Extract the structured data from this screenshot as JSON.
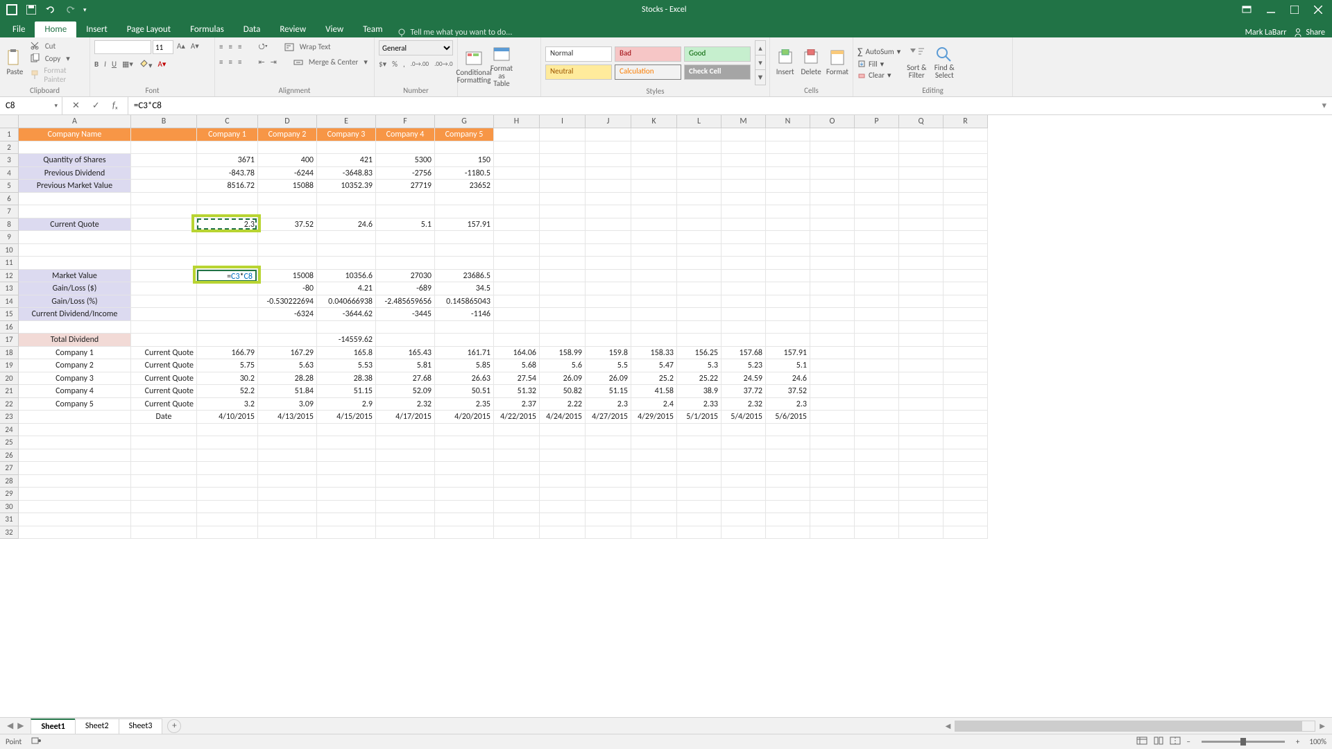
{
  "title": "Stocks - Excel",
  "user": "Mark LaBarr",
  "share": "Share",
  "tabs": [
    "File",
    "Home",
    "Insert",
    "Page Layout",
    "Formulas",
    "Data",
    "Review",
    "View",
    "Team"
  ],
  "activeTab": 1,
  "tellme": "Tell me what you want to do...",
  "ribbon": {
    "clipboard": {
      "label": "Clipboard",
      "paste": "Paste",
      "cut": "Cut",
      "copy": "Copy",
      "fp": "Format Painter"
    },
    "font": {
      "label": "Font",
      "size": "11"
    },
    "alignment": {
      "label": "Alignment",
      "wrap": "Wrap Text",
      "merge": "Merge & Center"
    },
    "number": {
      "label": "Number",
      "fmt": "General"
    },
    "cond": "Conditional Formatting",
    "fmtas": "Format as Table",
    "styles": {
      "label": "Styles",
      "cells": [
        "Normal",
        "Bad",
        "Good",
        "Neutral",
        "Calculation",
        "Check Cell"
      ]
    },
    "cells": {
      "label": "Cells",
      "insert": "Insert",
      "delete": "Delete",
      "format": "Format"
    },
    "editing": {
      "label": "Editing",
      "autosum": "AutoSum",
      "fill": "Fill",
      "clear": "Clear",
      "sort": "Sort & Filter",
      "find": "Find & Select"
    }
  },
  "formulaBar": {
    "name": "C8",
    "formula": "=C3*C8"
  },
  "colWidths": {
    "A": 162,
    "B": 95,
    "C": 88,
    "D": 85,
    "E": 85,
    "F": 85,
    "G": 85,
    "H": 66,
    "I": 66,
    "J": 66,
    "K": 66,
    "L": 64,
    "M": 64,
    "N": 64,
    "O": 64,
    "P": 64,
    "Q": 64,
    "R": 64
  },
  "columns": [
    "A",
    "B",
    "C",
    "D",
    "E",
    "F",
    "G",
    "H",
    "I",
    "J",
    "K",
    "L",
    "M",
    "N",
    "O",
    "P",
    "Q",
    "R"
  ],
  "rowCount": 32,
  "sheet": {
    "tabs": [
      "Sheet1",
      "Sheet2",
      "Sheet3"
    ],
    "active": 0
  },
  "status": "Point",
  "zoom": "100%",
  "editCell": {
    "row": 12,
    "col": "C",
    "parts": [
      "=",
      "C3",
      "*",
      "C8"
    ]
  },
  "selRef": {
    "row": 8,
    "col": "C"
  },
  "chart_data": {
    "type": "table",
    "title": "Stocks",
    "companies": [
      "Company 1",
      "Company 2",
      "Company 3",
      "Company 4",
      "Company 5"
    ],
    "quantity_of_shares": [
      3671,
      400,
      421,
      5300,
      150
    ],
    "previous_dividend": [
      -843.78,
      -6244,
      -3648.83,
      -2756,
      -1180.5
    ],
    "previous_market_value": [
      8516.72,
      15088,
      10352.39,
      27719,
      23652
    ],
    "current_quote": [
      2.3,
      37.52,
      24.6,
      5.1,
      157.91
    ],
    "market_value": [
      null,
      15008,
      10356.6,
      27030,
      23686.5
    ],
    "gain_loss_dollars": [
      null,
      -80,
      4.21,
      -689,
      34.5
    ],
    "gain_loss_pct": [
      null,
      -0.530222694,
      0.040666938,
      -2.485659656,
      0.145865043
    ],
    "current_dividend_income": [
      null,
      -6324,
      -3644.62,
      -3445,
      -1146
    ],
    "total_dividend": -14559.62,
    "history": {
      "dates": [
        "4/10/2015",
        "4/13/2015",
        "4/15/2015",
        "4/17/2015",
        "4/20/2015",
        "4/22/2015",
        "4/24/2015",
        "4/27/2015",
        "4/29/2015",
        "5/1/2015",
        "5/4/2015",
        "5/6/2015"
      ],
      "series": [
        {
          "name": "Company 1",
          "label": "Current Quote",
          "values": [
            166.79,
            167.29,
            165.8,
            165.43,
            161.71,
            164.06,
            158.99,
            159.8,
            158.33,
            156.25,
            157.68,
            157.91
          ]
        },
        {
          "name": "Company 2",
          "label": "Current Quote",
          "values": [
            5.75,
            5.63,
            5.53,
            5.81,
            5.85,
            5.68,
            5.6,
            5.5,
            5.47,
            5.3,
            5.23,
            5.1
          ]
        },
        {
          "name": "Company 3",
          "label": "Current Quote",
          "values": [
            30.2,
            28.28,
            28.38,
            27.68,
            26.63,
            27.54,
            26.09,
            26.09,
            25.2,
            25.22,
            24.59,
            24.6
          ]
        },
        {
          "name": "Company 4",
          "label": "Current Quote",
          "values": [
            52.2,
            51.84,
            51.15,
            52.09,
            50.51,
            51.32,
            50.82,
            51.15,
            41.58,
            38.9,
            37.72,
            37.52
          ]
        },
        {
          "name": "Company 5",
          "label": "Current Quote",
          "values": [
            3.2,
            3.09,
            2.9,
            2.32,
            2.35,
            2.37,
            2.22,
            2.3,
            2.4,
            2.33,
            2.32,
            2.3
          ]
        }
      ]
    }
  },
  "cells": {
    "1": {
      "A": {
        "v": "Company Name",
        "cls": "hdr-orange"
      },
      "B": {
        "v": "",
        "cls": "hdr-orange"
      },
      "C": {
        "v": "Company 1",
        "cls": "hdr-orange"
      },
      "D": {
        "v": "Company 2",
        "cls": "hdr-orange"
      },
      "E": {
        "v": "Company 3",
        "cls": "hdr-orange"
      },
      "F": {
        "v": "Company 4",
        "cls": "hdr-orange"
      },
      "G": {
        "v": "Company 5",
        "cls": "hdr-orange"
      }
    },
    "3": {
      "A": {
        "v": "Quantity of Shares",
        "cls": "hdr-lav"
      },
      "C": {
        "v": "3671"
      },
      "D": {
        "v": "400"
      },
      "E": {
        "v": "421"
      },
      "F": {
        "v": "5300"
      },
      "G": {
        "v": "150"
      }
    },
    "4": {
      "A": {
        "v": "Previous Dividend",
        "cls": "hdr-lav"
      },
      "C": {
        "v": "-843.78"
      },
      "D": {
        "v": "-6244"
      },
      "E": {
        "v": "-3648.83"
      },
      "F": {
        "v": "-2756"
      },
      "G": {
        "v": "-1180.5"
      }
    },
    "5": {
      "A": {
        "v": "Previous Market Value",
        "cls": "hdr-lav"
      },
      "C": {
        "v": "8516.72"
      },
      "D": {
        "v": "15088"
      },
      "E": {
        "v": "10352.39"
      },
      "F": {
        "v": "27719"
      },
      "G": {
        "v": "23652"
      }
    },
    "8": {
      "A": {
        "v": "Current Quote",
        "cls": "hdr-lav"
      },
      "C": {
        "v": "2.3"
      },
      "D": {
        "v": "37.52"
      },
      "E": {
        "v": "24.6"
      },
      "F": {
        "v": "5.1"
      },
      "G": {
        "v": "157.91"
      }
    },
    "12": {
      "A": {
        "v": "Market Value",
        "cls": "hdr-lav"
      },
      "D": {
        "v": "15008"
      },
      "E": {
        "v": "10356.6"
      },
      "F": {
        "v": "27030"
      },
      "G": {
        "v": "23686.5"
      }
    },
    "13": {
      "A": {
        "v": "Gain/Loss ($)",
        "cls": "hdr-lav"
      },
      "D": {
        "v": "-80"
      },
      "E": {
        "v": "4.21"
      },
      "F": {
        "v": "-689"
      },
      "G": {
        "v": "34.5"
      }
    },
    "14": {
      "A": {
        "v": "Gain/Loss (%)",
        "cls": "hdr-lav"
      },
      "D": {
        "v": "-0.530222694"
      },
      "E": {
        "v": "0.040666938"
      },
      "F": {
        "v": "-2.485659656"
      },
      "G": {
        "v": "0.145865043"
      }
    },
    "15": {
      "A": {
        "v": "Current Dividend/Income",
        "cls": "hdr-lav"
      },
      "D": {
        "v": "-6324"
      },
      "E": {
        "v": "-3644.62"
      },
      "F": {
        "v": "-3445"
      },
      "G": {
        "v": "-1146"
      }
    },
    "17": {
      "A": {
        "v": "Total Dividend",
        "cls": "hdr-pink"
      },
      "E": {
        "v": "-14559.62"
      }
    },
    "18": {
      "A": {
        "v": "Company 1",
        "cls": "centerTxt"
      },
      "B": {
        "v": "Current Quote"
      },
      "C": {
        "v": "166.79"
      },
      "D": {
        "v": "167.29"
      },
      "E": {
        "v": "165.8"
      },
      "F": {
        "v": "165.43"
      },
      "G": {
        "v": "161.71"
      },
      "H": {
        "v": "164.06"
      },
      "I": {
        "v": "158.99"
      },
      "J": {
        "v": "159.8"
      },
      "K": {
        "v": "158.33"
      },
      "L": {
        "v": "156.25"
      },
      "M": {
        "v": "157.68"
      },
      "N": {
        "v": "157.91"
      }
    },
    "19": {
      "A": {
        "v": "Company 2",
        "cls": "centerTxt"
      },
      "B": {
        "v": "Current Quote"
      },
      "C": {
        "v": "5.75"
      },
      "D": {
        "v": "5.63"
      },
      "E": {
        "v": "5.53"
      },
      "F": {
        "v": "5.81"
      },
      "G": {
        "v": "5.85"
      },
      "H": {
        "v": "5.68"
      },
      "I": {
        "v": "5.6"
      },
      "J": {
        "v": "5.5"
      },
      "K": {
        "v": "5.47"
      },
      "L": {
        "v": "5.3"
      },
      "M": {
        "v": "5.23"
      },
      "N": {
        "v": "5.1"
      }
    },
    "20": {
      "A": {
        "v": "Company 3",
        "cls": "centerTxt"
      },
      "B": {
        "v": "Current Quote"
      },
      "C": {
        "v": "30.2"
      },
      "D": {
        "v": "28.28"
      },
      "E": {
        "v": "28.38"
      },
      "F": {
        "v": "27.68"
      },
      "G": {
        "v": "26.63"
      },
      "H": {
        "v": "27.54"
      },
      "I": {
        "v": "26.09"
      },
      "J": {
        "v": "26.09"
      },
      "K": {
        "v": "25.2"
      },
      "L": {
        "v": "25.22"
      },
      "M": {
        "v": "24.59"
      },
      "N": {
        "v": "24.6"
      }
    },
    "21": {
      "A": {
        "v": "Company 4",
        "cls": "centerTxt"
      },
      "B": {
        "v": "Current Quote"
      },
      "C": {
        "v": "52.2"
      },
      "D": {
        "v": "51.84"
      },
      "E": {
        "v": "51.15"
      },
      "F": {
        "v": "52.09"
      },
      "G": {
        "v": "50.51"
      },
      "H": {
        "v": "51.32"
      },
      "I": {
        "v": "50.82"
      },
      "J": {
        "v": "51.15"
      },
      "K": {
        "v": "41.58"
      },
      "L": {
        "v": "38.9"
      },
      "M": {
        "v": "37.72"
      },
      "N": {
        "v": "37.52"
      }
    },
    "22": {
      "A": {
        "v": "Company 5",
        "cls": "centerTxt"
      },
      "B": {
        "v": "Current Quote"
      },
      "C": {
        "v": "3.2"
      },
      "D": {
        "v": "3.09"
      },
      "E": {
        "v": "2.9"
      },
      "F": {
        "v": "2.32"
      },
      "G": {
        "v": "2.35"
      },
      "H": {
        "v": "2.37"
      },
      "I": {
        "v": "2.22"
      },
      "J": {
        "v": "2.3"
      },
      "K": {
        "v": "2.4"
      },
      "L": {
        "v": "2.33"
      },
      "M": {
        "v": "2.32"
      },
      "N": {
        "v": "2.3"
      }
    },
    "23": {
      "B": {
        "v": "Date",
        "cls": "centerTxt"
      },
      "C": {
        "v": "4/10/2015"
      },
      "D": {
        "v": "4/13/2015"
      },
      "E": {
        "v": "4/15/2015"
      },
      "F": {
        "v": "4/17/2015"
      },
      "G": {
        "v": "4/20/2015"
      },
      "H": {
        "v": "4/22/2015"
      },
      "I": {
        "v": "4/24/2015"
      },
      "J": {
        "v": "4/27/2015"
      },
      "K": {
        "v": "4/29/2015"
      },
      "L": {
        "v": "5/1/2015"
      },
      "M": {
        "v": "5/4/2015"
      },
      "N": {
        "v": "5/6/2015"
      }
    }
  }
}
